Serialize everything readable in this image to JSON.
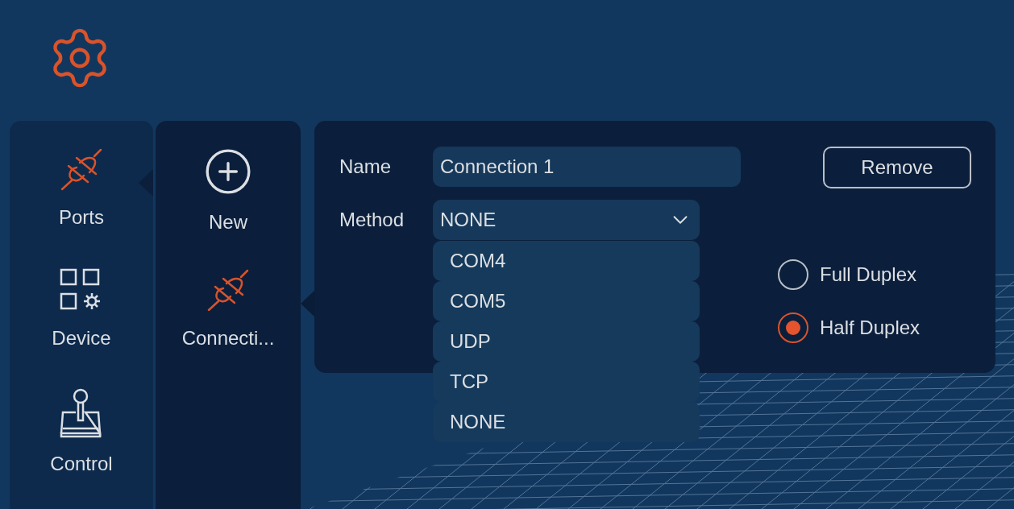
{
  "sidebar": {
    "items": [
      {
        "kind": "ports",
        "label": "Ports",
        "selected": true
      },
      {
        "kind": "device",
        "label": "Device",
        "selected": false
      },
      {
        "kind": "control",
        "label": "Control",
        "selected": false
      }
    ]
  },
  "connections": {
    "items": [
      {
        "kind": "new",
        "label": "New",
        "selected": false
      },
      {
        "kind": "connection",
        "label": "Connecti...",
        "selected": true
      }
    ]
  },
  "form": {
    "name": {
      "label": "Name",
      "value": "Connection 1"
    },
    "method": {
      "label": "Method",
      "value": "NONE",
      "expanded": true,
      "options": [
        "COM4",
        "COM5",
        "UDP",
        "TCP",
        "NONE"
      ]
    },
    "remove_button": "Remove",
    "duplex": [
      {
        "label": "Full Duplex",
        "selected": false
      },
      {
        "label": "Half Duplex",
        "selected": true
      }
    ]
  }
}
